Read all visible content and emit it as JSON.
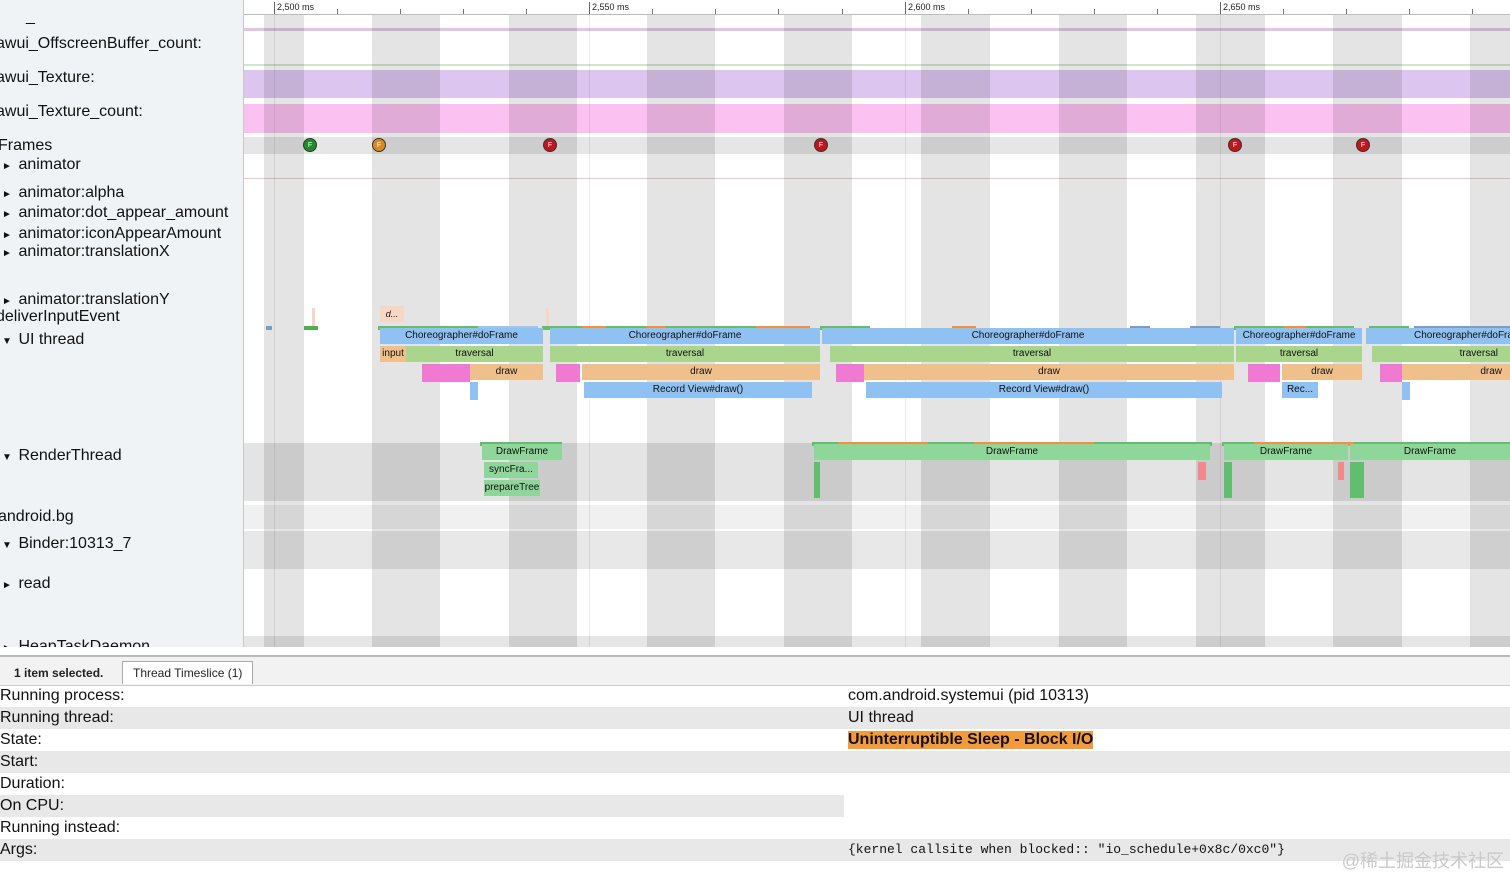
{
  "sidebar": {
    "tracks": [
      {
        "label": "_",
        "arrow": ""
      },
      {
        "label": "awui_OffscreenBuffer_count:",
        "arrow": ""
      },
      {
        "label": "awui_Texture:",
        "arrow": ""
      },
      {
        "label": "awui_Texture_count:",
        "arrow": ""
      },
      {
        "label": "Frames",
        "arrow": ""
      },
      {
        "label": "animator",
        "arrow": "►"
      },
      {
        "label": "animator:alpha",
        "arrow": "►"
      },
      {
        "label": "animator:dot_appear_amount",
        "arrow": "►"
      },
      {
        "label": "animator:iconAppearAmount",
        "arrow": "►"
      },
      {
        "label": "animator:translationX",
        "arrow": "►"
      },
      {
        "label": "animator:translationY",
        "arrow": "►"
      },
      {
        "label": "deliverInputEvent",
        "arrow": ""
      },
      {
        "label": "UI thread",
        "arrow": "▼"
      },
      {
        "label": "RenderThread",
        "arrow": "▼"
      },
      {
        "label": "android.bg",
        "arrow": ""
      },
      {
        "label": "Binder:10313_7",
        "arrow": "▼"
      },
      {
        "label": "read",
        "arrow": "►"
      },
      {
        "label": "HeapTaskDaemon",
        "arrow": "►"
      }
    ]
  },
  "ruler": {
    "ticks": [
      "2,500 ms",
      "2,550 ms",
      "2,600 ms",
      "2,650 ms"
    ]
  },
  "frames": {
    "markers": [
      {
        "label": "F",
        "color": "#1e8c2a"
      },
      {
        "label": "F",
        "color": "#d88a1e"
      },
      {
        "label": "F",
        "color": "#c4141c"
      },
      {
        "label": "F",
        "color": "#c4141c"
      },
      {
        "label": "F",
        "color": "#c4141c"
      },
      {
        "label": "F",
        "color": "#c4141c"
      }
    ]
  },
  "slices": {
    "deliver_input": "d...",
    "ui": {
      "choreo1": "Choreographer#doFrame",
      "choreo2": "Choreographer#doFrame",
      "choreo3": "Choreographer#doFrame",
      "choreo4": "Choreographer#doFrame",
      "choreo5": "Choreographer#doFra",
      "input": "input",
      "trav1": "traversal",
      "trav2": "traversal",
      "trav3": "traversal",
      "trav4": "traversal",
      "trav5": "traversal",
      "draw1": "draw",
      "draw2": "draw",
      "draw3": "draw",
      "draw4": "draw",
      "draw5": "draw",
      "rec1": "Record View#draw()",
      "rec2": "Record View#draw()",
      "rec3": "Rec..."
    },
    "render": {
      "df1": "DrawFrame",
      "sync": "syncFra...",
      "prep": "prepareTree",
      "df2": "DrawFrame",
      "df3": "DrawFrame",
      "df4": "DrawFrame"
    }
  },
  "details": {
    "selected_count": "1 item selected.",
    "tab_label": "Thread Timeslice (1)",
    "rows": [
      {
        "key": "Running process:",
        "value": "com.android.systemui (pid 10313)"
      },
      {
        "key": "Running thread:",
        "value": "UI thread"
      },
      {
        "key": "State:",
        "value": "Uninterruptible Sleep - Block I/O"
      },
      {
        "key": "Start:",
        "value": ""
      },
      {
        "key": "Duration:",
        "value": ""
      },
      {
        "key": "On CPU:",
        "value": ""
      },
      {
        "key": "Running instead:",
        "value": ""
      },
      {
        "key": "Args:",
        "value": "{kernel callsite when blocked:: \"io_schedule+0x8c/0xc0\"}"
      }
    ],
    "state_color": "#f39a3c"
  },
  "watermark": "@稀土掘金技术社区"
}
